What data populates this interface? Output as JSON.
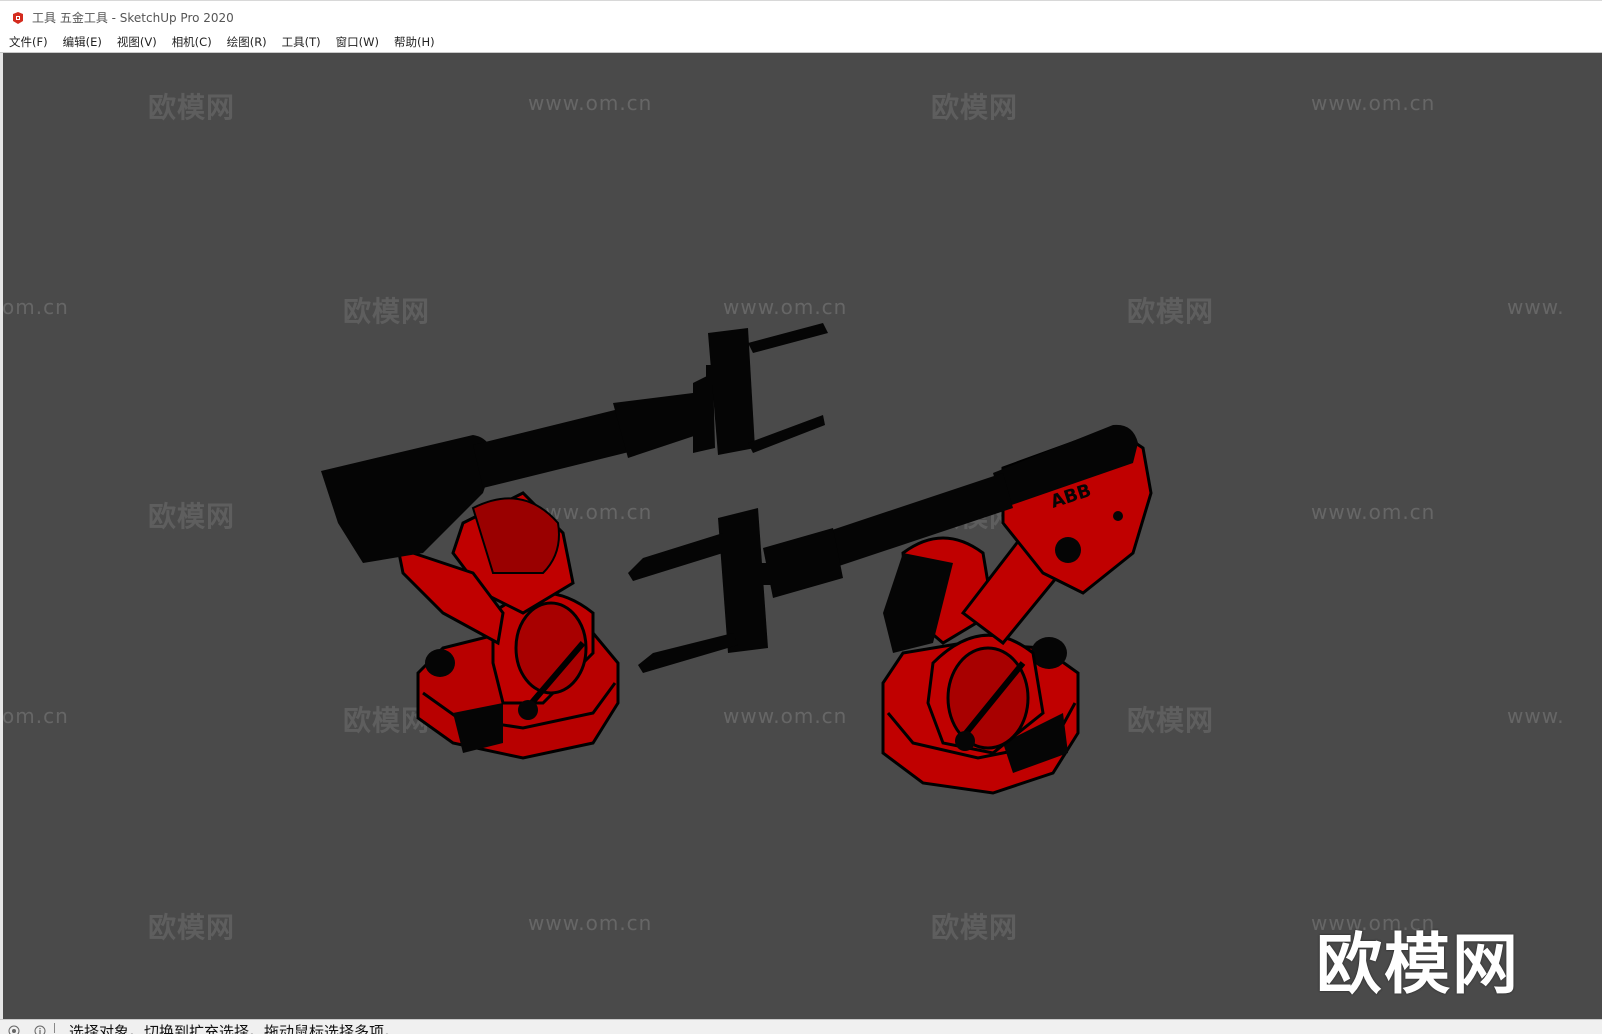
{
  "window": {
    "title": "工具 五金工具 - SketchUp Pro 2020",
    "app_icon": "sketchup-logo-icon"
  },
  "menubar": {
    "items": [
      {
        "label": "文件(F)"
      },
      {
        "label": "编辑(E)"
      },
      {
        "label": "视图(V)"
      },
      {
        "label": "相机(C)"
      },
      {
        "label": "绘图(R)"
      },
      {
        "label": "工具(T)"
      },
      {
        "label": "窗口(W)"
      },
      {
        "label": "帮助(H)"
      }
    ]
  },
  "viewport": {
    "background_color": "#4a4a4a",
    "model_colors": {
      "arm_red": "#c00000",
      "arm_black": "#050505"
    },
    "watermark_cn": "欧模网",
    "watermark_url": "www.om.cn",
    "watermark_url_fragment_left": "om.cn",
    "watermark_url_fragment_right": "www.",
    "logo_text": "欧模网",
    "model_label": "ABB"
  },
  "statusbar": {
    "icons": [
      "geo-location-icon",
      "info-icon"
    ],
    "hint": "选择对象。切换到扩充选择。拖动鼠标选择多项。"
  }
}
